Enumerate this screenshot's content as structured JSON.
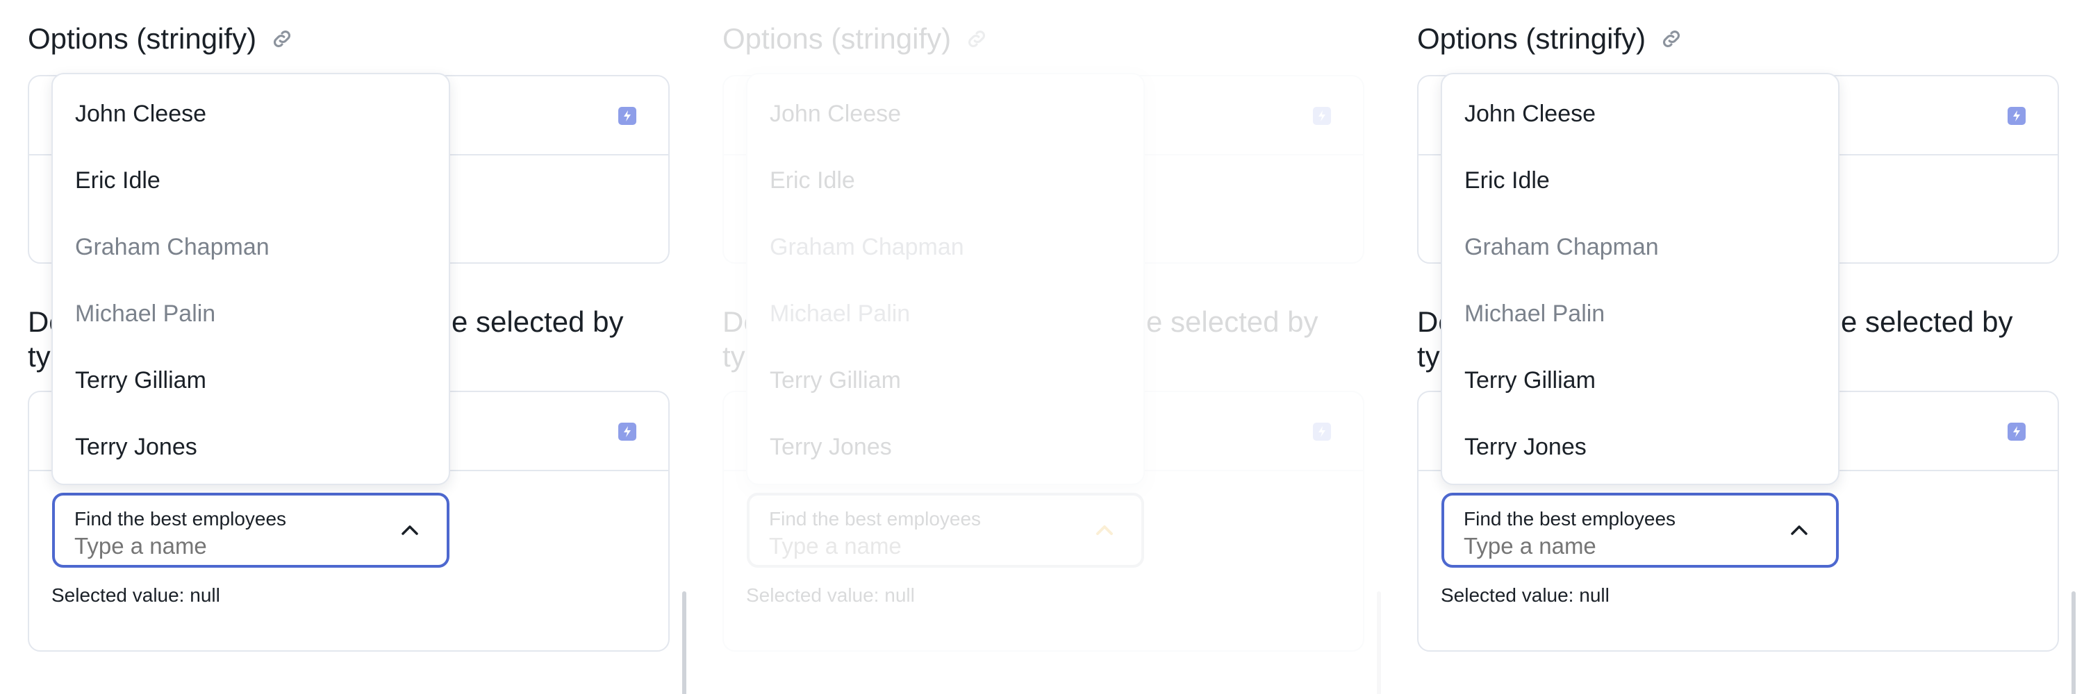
{
  "frames": [
    {
      "heading": "Options (stringify)",
      "heading2_parts": [
        "De",
        "ty",
        "e selected by"
      ],
      "options": [
        {
          "label": "John Cleese",
          "disabled": false
        },
        {
          "label": "Eric Idle",
          "disabled": false
        },
        {
          "label": "Graham Chapman",
          "disabled": true
        },
        {
          "label": "Michael Palin",
          "disabled": true
        },
        {
          "label": "Terry Gilliam",
          "disabled": false
        },
        {
          "label": "Terry Jones",
          "disabled": false
        }
      ],
      "field_label": "Find the best employees",
      "field_placeholder": "Type a name",
      "selected_text": "Selected value: null"
    },
    {
      "heading": "Options (stringify)",
      "heading2_parts": [
        "De",
        "ty",
        "e selected by"
      ],
      "options": [
        {
          "label": "John Cleese",
          "disabled": false
        },
        {
          "label": "Eric Idle",
          "disabled": false
        },
        {
          "label": "Graham Chapman",
          "disabled": true
        },
        {
          "label": "Michael Palin",
          "disabled": true
        },
        {
          "label": "Terry Gilliam",
          "disabled": false
        },
        {
          "label": "Terry Jones",
          "disabled": false
        }
      ],
      "field_label": "Find the best employees",
      "field_placeholder": "Type a name",
      "selected_text": "Selected value: null"
    },
    {
      "heading": "Options (stringify)",
      "heading2_parts": [
        "De",
        "ty",
        "e selected by"
      ],
      "options": [
        {
          "label": "John Cleese",
          "disabled": false
        },
        {
          "label": "Eric Idle",
          "disabled": false
        },
        {
          "label": "Graham Chapman",
          "disabled": true
        },
        {
          "label": "Michael Palin",
          "disabled": true
        },
        {
          "label": "Terry Gilliam",
          "disabled": false
        },
        {
          "label": "Terry Jones",
          "disabled": false
        }
      ],
      "field_label": "Find the best employees",
      "field_placeholder": "Type a name",
      "selected_text": "Selected value: null"
    }
  ],
  "colors": {
    "accent": "#4d68cf",
    "bolt": "#8e9ee9",
    "border": "#e3e7ee",
    "disabled_text": "#7b828c",
    "caret_highlight": "#e8a300"
  },
  "icons": [
    "link-icon",
    "bolt-icon",
    "chevron-up-icon"
  ]
}
